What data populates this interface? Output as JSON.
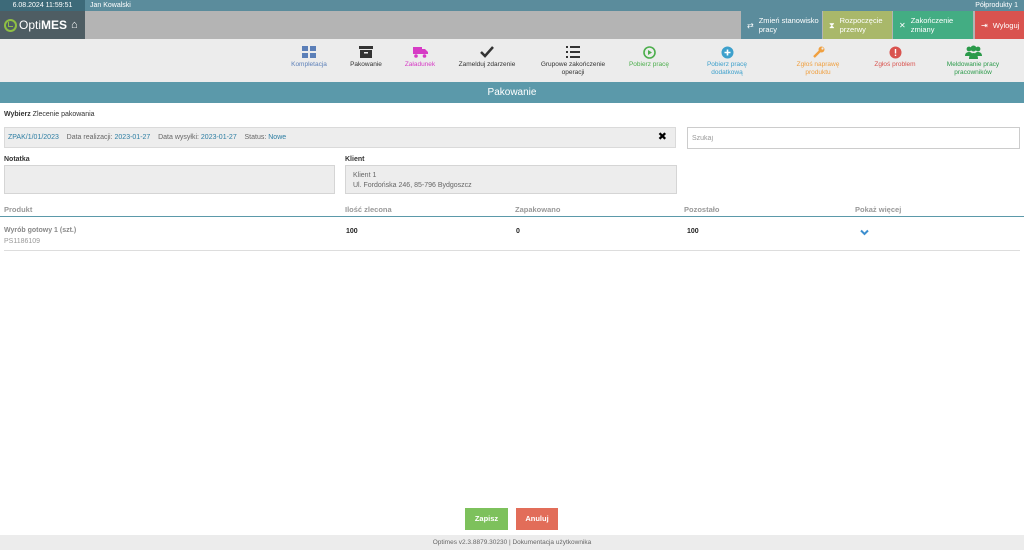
{
  "topbar": {
    "datetime": "6.08.2024 11:59:51",
    "user": "Jan Kowalski",
    "module": "Półprodukty 1"
  },
  "header": {
    "logo_prefix": "Opti",
    "logo_suffix": "MES",
    "buttons": [
      {
        "label": "Zmień stanowisko pracy"
      },
      {
        "label": "Rozpoczęcie przerwy"
      },
      {
        "label": "Zakończenie zmiany"
      },
      {
        "label": "Wyloguj"
      }
    ]
  },
  "toolbar": [
    {
      "label": "Kompletacja",
      "icon": "grid-icon",
      "color": "#5b7fb8"
    },
    {
      "label": "Pakowanie",
      "icon": "archive-icon",
      "color": "#333333"
    },
    {
      "label": "Załadunek",
      "icon": "truck-icon",
      "color": "#d63bc5"
    },
    {
      "label": "Zamelduj zdarzenie",
      "icon": "check-icon",
      "color": "#333333"
    },
    {
      "label": "Grupowe zakończenie operacji",
      "icon": "list-icon",
      "color": "#333333"
    },
    {
      "label": "Pobierz pracę",
      "icon": "play-icon",
      "color": "#4cae4c"
    },
    {
      "label": "Pobierz pracę dodatkową",
      "icon": "plus-circle-icon",
      "color": "#3da0cc"
    },
    {
      "label": "Zgłoś naprawę produktu",
      "icon": "wrench-icon",
      "color": "#f0a040"
    },
    {
      "label": "Zgłoś problem",
      "icon": "alert-icon",
      "color": "#d9534f"
    },
    {
      "label": "Meldowanie pracy pracowników",
      "icon": "users-icon",
      "color": "#2b9a4a"
    }
  ],
  "title": "Pakowanie",
  "select_label_bold": "Wybierz",
  "select_label_rest": "Zlecenie pakowania",
  "order": {
    "number": "ZPAK/1/01/2023",
    "realization_label": "Data realizacji:",
    "realization_date": "2023-01-27",
    "shipping_label": "Data wysyłki:",
    "shipping_date": "2023-01-27",
    "status_label": "Status:",
    "status": "Nowe"
  },
  "search": {
    "placeholder": "Szukaj"
  },
  "note_label": "Notatka",
  "client_label": "Klient",
  "client": {
    "name": "Klient 1",
    "address": "Ul. Fordońska 246, 85-796 Bydgoszcz"
  },
  "table": {
    "headers": [
      "Produkt",
      "Ilość zlecona",
      "Zapakowano",
      "Pozostało",
      "Pokaż więcej"
    ],
    "rows": [
      {
        "product": "Wyrób gotowy 1 (szt.)",
        "code": "PS1186109",
        "ordered": "100",
        "packed": "0",
        "remaining": "100"
      }
    ]
  },
  "actions": {
    "save": "Zapisz",
    "cancel": "Anuluj"
  },
  "footer": "Optimes v2.3.8879.30230 | Dokumentacja użytkownika"
}
